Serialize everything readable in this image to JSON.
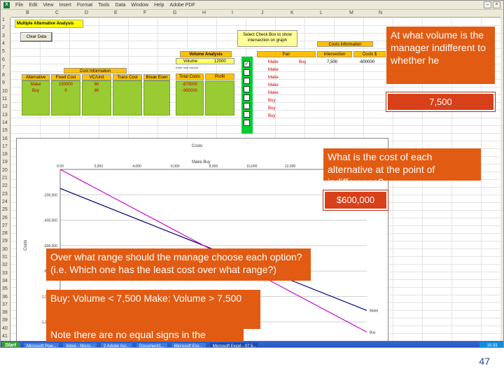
{
  "window": {
    "menu_items": [
      "File",
      "Edit",
      "View",
      "Insert",
      "Format",
      "Tools",
      "Data",
      "Window",
      "Help",
      "Adobe PDF"
    ],
    "col_headers": [
      "B",
      "C",
      "D",
      "E",
      "F",
      "G",
      "H",
      "I",
      "J",
      "K",
      "L",
      "M",
      "N"
    ],
    "row_headers": [
      "1",
      "2",
      "3",
      "4",
      "5",
      "6",
      "7",
      "8",
      "9",
      "10",
      "11",
      "12",
      "13",
      "14",
      "15",
      "16",
      "17",
      "18",
      "19",
      "20",
      "21",
      "22",
      "23",
      "24",
      "25",
      "26",
      "27",
      "28",
      "29",
      "30",
      "31",
      "32",
      "33",
      "34",
      "35",
      "36",
      "37",
      "38",
      "39",
      "40",
      "41"
    ]
  },
  "sheet": {
    "title": "Multiple Alternative Analysis",
    "clear_button": "Clear Data",
    "cost_info": {
      "title": "Cost Information",
      "headers": [
        "Alternative",
        "Fixed Cost",
        "VC/Unit",
        "Trans Cost",
        "Break Even"
      ],
      "alternatives": [
        "Make",
        "Buy"
      ],
      "fixed_costs": [
        "150000",
        "0"
      ],
      "vc_units": [
        "60",
        "80"
      ]
    },
    "volume": {
      "title": "Volume Analysis",
      "label": "Volume",
      "value": "12000",
      "sub": "Enter new volume",
      "headers": [
        "Total Costs",
        "Profit"
      ],
      "totals": [
        "-870000",
        "-960000"
      ]
    },
    "select_note": "Select Check Box to show intersection on graph",
    "pairs": {
      "title": "Costs Information",
      "headers": [
        "Pair",
        "Intersection",
        "Costs $"
      ],
      "rows": [
        {
          "a": "Make",
          "b": "Buy",
          "c": "7,500",
          "d": "-600000"
        },
        {
          "a": "Make",
          "b": "",
          "c": "",
          "d": ""
        },
        {
          "a": "Make",
          "b": "",
          "c": "",
          "d": ""
        },
        {
          "a": "Make",
          "b": "",
          "c": "",
          "d": ""
        },
        {
          "a": "Make",
          "b": "",
          "c": "",
          "d": ""
        },
        {
          "a": "Buy",
          "b": "",
          "c": "",
          "d": ""
        },
        {
          "a": "Buy",
          "b": "",
          "c": "",
          "d": ""
        },
        {
          "a": "Buy",
          "b": "",
          "c": "",
          "d": ""
        }
      ]
    }
  },
  "chart": {
    "title": "Costs",
    "legend_top": "Make Buy",
    "ylabel": "Costs"
  },
  "chart_data": {
    "type": "line",
    "title": "Costs",
    "xlabel": "",
    "ylabel": "Costs",
    "x_ticks": [
      "0.00",
      "2,000",
      "4,000",
      "6,000",
      "8,000",
      "10,000",
      "12,000",
      "14,000"
    ],
    "y_ticks": [
      "-200,000",
      "-400,000",
      "-600,000",
      "-800,000",
      "-1,000,000",
      "-1,200,000"
    ],
    "xlim": [
      0,
      16000
    ],
    "ylim": [
      -1300000,
      0
    ],
    "series": [
      {
        "name": "Make",
        "x": [
          0,
          16000
        ],
        "y": [
          -150000,
          -1110000
        ],
        "color": "#000080"
      },
      {
        "name": "Buy",
        "x": [
          0,
          16000
        ],
        "y": [
          0,
          -1280000
        ],
        "color": "#cc00cc"
      }
    ]
  },
  "callouts": {
    "q1": "At what volume is the manager indifferent to whether he",
    "a1": "7,500",
    "q2": "What is the cost of each alternative at the point of indifference?",
    "a2": "$600,000",
    "q3": "Over what range should the manage choose each option? (i.e. Which one has the least cost over what range?)",
    "a3": "Buy:  Volume < 7,500  Make:  Volume > 7,500",
    "note": "Note there are no equal signs in the answer!"
  },
  "taskbar": {
    "start": "Start",
    "items": [
      "Microsoft Pow...",
      "Inbox - Micro...",
      "2 Adobe Acr...",
      "Document1...",
      "Microsoft Exc...",
      "Microsoft Excel - 07.5..."
    ],
    "tray": "10:33"
  },
  "slide_number": "47"
}
